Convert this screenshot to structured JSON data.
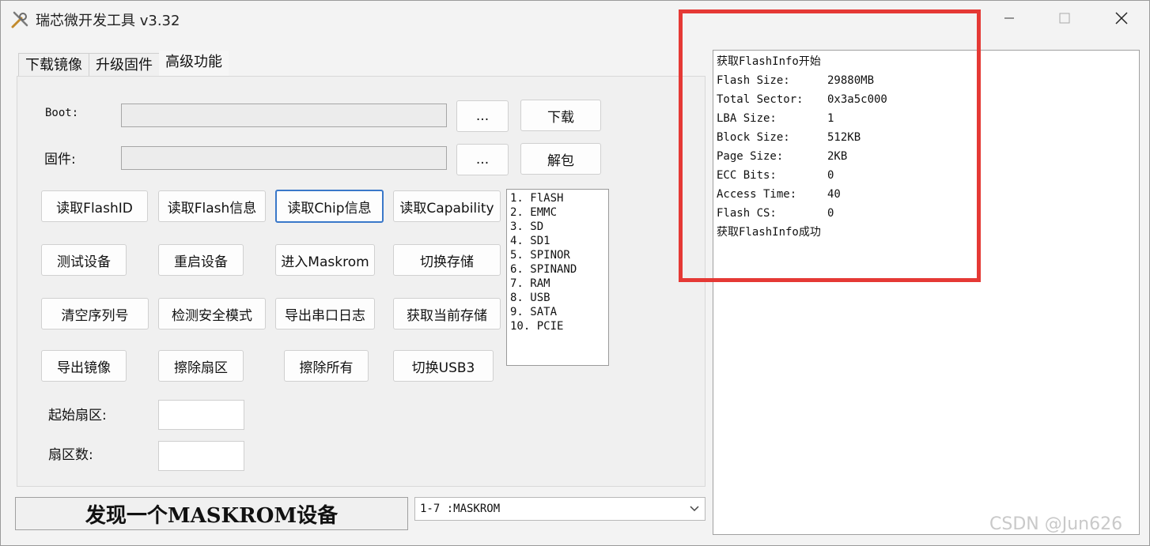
{
  "window": {
    "title": "瑞芯微开发工具 v3.32"
  },
  "tabs": [
    "下载镜像",
    "升级固件",
    "高级功能"
  ],
  "boot": {
    "label": "Boot:",
    "browse": "...",
    "action": "下载"
  },
  "firmware": {
    "label": "固件:",
    "browse": "...",
    "action": "解包"
  },
  "buttons": {
    "read_flash_id": "读取FlashID",
    "read_flash_info": "读取Flash信息",
    "read_chip_info": "读取Chip信息",
    "read_capability": "读取Capability",
    "test_device": "测试设备",
    "reboot_device": "重启设备",
    "enter_maskrom": "进入Maskrom",
    "switch_storage": "切换存储",
    "clear_serial": "清空序列号",
    "detect_safe_mode": "检测安全模式",
    "export_serial_log": "导出串口日志",
    "get_current_storage": "获取当前存储",
    "export_image": "导出镜像",
    "erase_sector": "擦除扇区",
    "erase_all": "擦除所有",
    "switch_usb3": "切换USB3"
  },
  "storage_list": [
    "1. FlASH",
    "2. EMMC",
    "3. SD",
    "4. SD1",
    "5. SPINOR",
    "6. SPINAND",
    "7. RAM",
    "8. USB",
    "9. SATA",
    "10. PCIE"
  ],
  "start_sector": {
    "label": "起始扇区:",
    "value": ""
  },
  "sector_count": {
    "label": "扇区数:",
    "value": ""
  },
  "status": {
    "text": "发现一个MASKROM设备"
  },
  "device_select": {
    "value": "1-7 :MASKROM"
  },
  "log": {
    "start": "获取FlashInfo开始",
    "rows": [
      {
        "key": "Flash Size:",
        "value": "29880MB"
      },
      {
        "key": "Total Sector:",
        "value": "0x3a5c000"
      },
      {
        "key": "LBA Size:",
        "value": "1"
      },
      {
        "key": "Block Size:",
        "value": "512KB"
      },
      {
        "key": "Page Size:",
        "value": "2KB"
      },
      {
        "key": "ECC Bits:",
        "value": "0"
      },
      {
        "key": "Access Time:",
        "value": "40"
      },
      {
        "key": "Flash CS:",
        "value": "0"
      }
    ],
    "end": "获取FlashInfo成功"
  },
  "watermark": "CSDN @Jun626",
  "colors": {
    "highlight": "#e53935",
    "focus": "#3a78c9"
  },
  "icons": {
    "app": "tools-icon",
    "minimize": "minimize-icon",
    "maximize": "maximize-icon",
    "close": "close-icon",
    "dropdown": "chevron-down-icon"
  }
}
